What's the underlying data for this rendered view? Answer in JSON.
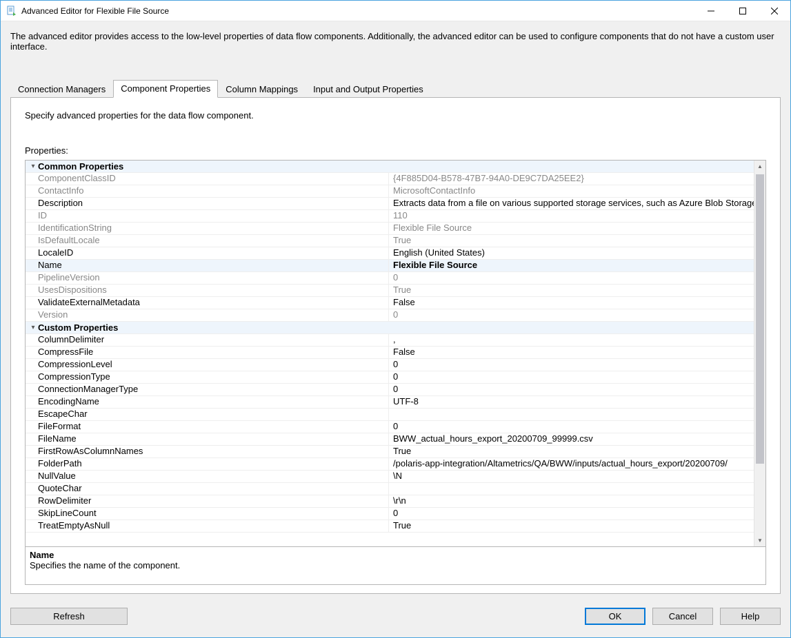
{
  "window": {
    "title": "Advanced Editor for Flexible File Source",
    "description": "The advanced editor provides access to the low-level properties of data flow components. Additionally, the advanced editor can be used to configure components that do not have a custom user interface."
  },
  "tabs": [
    {
      "label": "Connection Managers"
    },
    {
      "label": "Component Properties"
    },
    {
      "label": "Column Mappings"
    },
    {
      "label": "Input and Output Properties"
    }
  ],
  "active_tab": 1,
  "tab_instruction": "Specify advanced properties for the data flow component.",
  "properties_label": "Properties:",
  "groups": [
    {
      "title": "Common Properties",
      "rows": [
        {
          "name": "ComponentClassID",
          "value": "{4F885D04-B578-47B7-94A0-DE9C7DA25EE2}",
          "readonly": true
        },
        {
          "name": "ContactInfo",
          "value": "MicrosoftContactInfo",
          "readonly": true
        },
        {
          "name": "Description",
          "value": "Extracts data from a file on various supported storage services, such as Azure Blob Storage and Azur"
        },
        {
          "name": "ID",
          "value": "110",
          "readonly": true
        },
        {
          "name": "IdentificationString",
          "value": "Flexible File Source",
          "readonly": true
        },
        {
          "name": "IsDefaultLocale",
          "value": "True",
          "readonly": true
        },
        {
          "name": "LocaleID",
          "value": "English (United States)"
        },
        {
          "name": "Name",
          "value": "Flexible File Source",
          "bold": true,
          "selected": true
        },
        {
          "name": "PipelineVersion",
          "value": "0",
          "readonly": true
        },
        {
          "name": "UsesDispositions",
          "value": "True",
          "readonly": true
        },
        {
          "name": "ValidateExternalMetadata",
          "value": "False"
        },
        {
          "name": "Version",
          "value": "0",
          "readonly": true
        }
      ]
    },
    {
      "title": "Custom Properties",
      "rows": [
        {
          "name": "ColumnDelimiter",
          "value": ","
        },
        {
          "name": "CompressFile",
          "value": "False"
        },
        {
          "name": "CompressionLevel",
          "value": "0"
        },
        {
          "name": "CompressionType",
          "value": "0"
        },
        {
          "name": "ConnectionManagerType",
          "value": "0"
        },
        {
          "name": "EncodingName",
          "value": "UTF-8"
        },
        {
          "name": "EscapeChar",
          "value": ""
        },
        {
          "name": "FileFormat",
          "value": "0"
        },
        {
          "name": "FileName",
          "value": "BWW_actual_hours_export_20200709_99999.csv"
        },
        {
          "name": "FirstRowAsColumnNames",
          "value": "True"
        },
        {
          "name": "FolderPath",
          "value": "/polaris-app-integration/Altametrics/QA/BWW/inputs/actual_hours_export/20200709/"
        },
        {
          "name": "NullValue",
          "value": "\\N"
        },
        {
          "name": "QuoteChar",
          "value": ""
        },
        {
          "name": "RowDelimiter",
          "value": "\\r\\n"
        },
        {
          "name": "SkipLineCount",
          "value": "0"
        },
        {
          "name": "TreatEmptyAsNull",
          "value": "True"
        }
      ]
    }
  ],
  "desc_panel": {
    "title": "Name",
    "text": "Specifies the name of the component."
  },
  "buttons": {
    "refresh": "Refresh",
    "ok": "OK",
    "cancel": "Cancel",
    "help": "Help"
  }
}
